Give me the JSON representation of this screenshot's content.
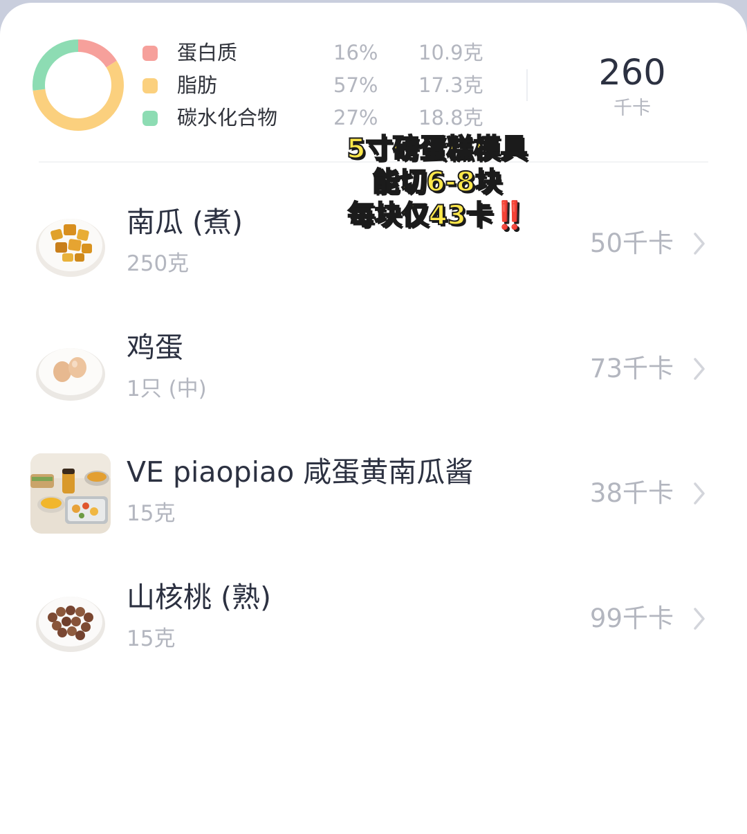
{
  "summary": {
    "macros": [
      {
        "name": "蛋白质",
        "percent": "16%",
        "amount": "10.9克",
        "color": "#f6a09b"
      },
      {
        "name": "脂肪",
        "percent": "57%",
        "amount": "17.3克",
        "color": "#fbd07e"
      },
      {
        "name": "碳水化合物",
        "percent": "27%",
        "amount": "18.8克",
        "color": "#8ddcb3"
      }
    ],
    "donut_fractions": [
      0.16,
      0.57,
      0.27
    ],
    "total_value": "260",
    "total_unit": "千卡"
  },
  "caption": {
    "line1": "5寸磅蛋糕模具",
    "line2": "能切6-8块",
    "line3": "每块仅43卡",
    "emphasis": "‼️"
  },
  "foods": [
    {
      "name": "南瓜 (煮)",
      "amount": "250克",
      "kcal": "50千卡",
      "icon": "boiled-pumpkin-image"
    },
    {
      "name": "鸡蛋",
      "amount": "1只 (中)",
      "kcal": "73千卡",
      "icon": "eggs-image"
    },
    {
      "name": "VE piaopiao 咸蛋黄南瓜酱",
      "amount": "15克",
      "kcal": "38千卡",
      "icon": "pumpkin-sauce-product-image"
    },
    {
      "name": "山核桃 (熟)",
      "amount": "15克",
      "kcal": "99千卡",
      "icon": "hickory-nuts-image"
    }
  ],
  "colors": {
    "text_primary": "#2c3141",
    "text_secondary": "#b3b6bf",
    "caption_fill": "#ffe84a",
    "caption_emphasis": "#e52323"
  }
}
